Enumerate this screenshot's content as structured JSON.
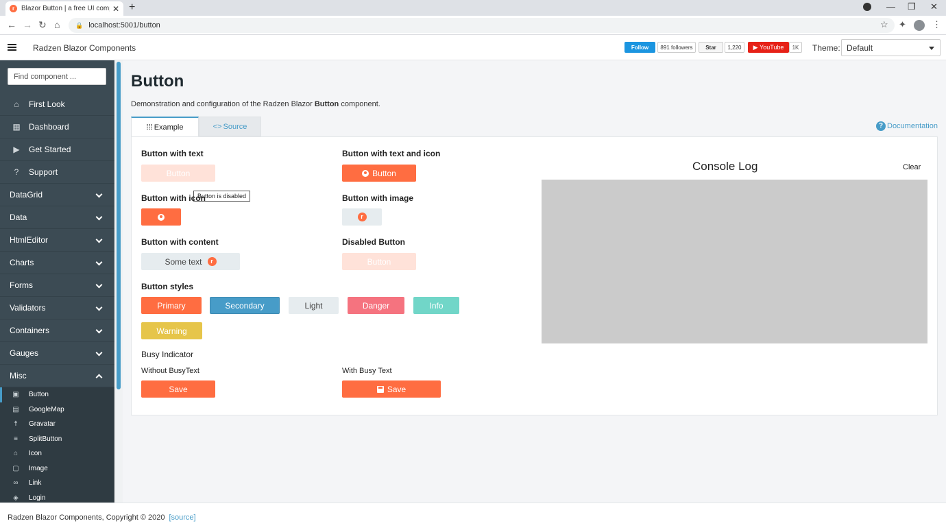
{
  "browser": {
    "tab_title": "Blazor Button | a free UI compon",
    "tab_close": "✕",
    "new_tab": "+",
    "url": "localhost:5001/button",
    "win_min": "—",
    "win_max": "❐",
    "win_close": "✕"
  },
  "header": {
    "app_title": "Radzen Blazor Components",
    "twitter_follow": "Follow",
    "twitter_followers": "891 followers",
    "github_star": "Star",
    "github_count": "1,220",
    "youtube": "YouTube",
    "youtube_count": "1K",
    "theme_label": "Theme:",
    "theme_value": "Default"
  },
  "sidebar": {
    "search_placeholder": "Find component ...",
    "items": [
      {
        "label": "First Look",
        "icon": "home-icon"
      },
      {
        "label": "Dashboard",
        "icon": "dashboard-icon"
      },
      {
        "label": "Get Started",
        "icon": "play-icon"
      },
      {
        "label": "Support",
        "icon": "help-icon"
      }
    ],
    "groups": [
      "DataGrid",
      "Data",
      "HtmlEditor",
      "Charts",
      "Forms",
      "Validators",
      "Containers",
      "Gauges",
      "Misc"
    ],
    "sub_items": [
      "Button",
      "GoogleMap",
      "Gravatar",
      "SplitButton",
      "Icon",
      "Image",
      "Link",
      "Login"
    ]
  },
  "page": {
    "title": "Button",
    "desc_pre": "Demonstration and configuration of the Radzen Blazor ",
    "desc_bold": "Button",
    "desc_post": " component.",
    "tab_example": "Example",
    "tab_source": "Source",
    "documentation": "Documentation"
  },
  "demo": {
    "h_text": "Button with text",
    "h_text_icon": "Button with text and icon",
    "h_icon": "Button with icon",
    "h_image": "Button with image",
    "h_content": "Button with content",
    "h_disabled": "Disabled Button",
    "h_styles": "Button styles",
    "h_busy": "Busy Indicator",
    "h_without_busy": "Without BusyText",
    "h_with_busy": "With Busy Text",
    "btn_text": "Button",
    "btn_text_icon": "Button",
    "btn_content": "Some text",
    "btn_disabled": "Button",
    "tooltip": "Button is disabled",
    "styles": {
      "primary": "Primary",
      "secondary": "Secondary",
      "light": "Light",
      "danger": "Danger",
      "info": "Info",
      "warning": "Warning"
    },
    "save": "Save",
    "save_busy": "Save"
  },
  "console": {
    "title": "Console Log",
    "clear": "Clear"
  },
  "footer": {
    "copyright": "Radzen Blazor Components, Copyright © 2020",
    "source": "[source]"
  },
  "colors": {
    "primary": "#ff6d41",
    "secondary": "#479cc8",
    "sidebar": "#3c4b54"
  }
}
